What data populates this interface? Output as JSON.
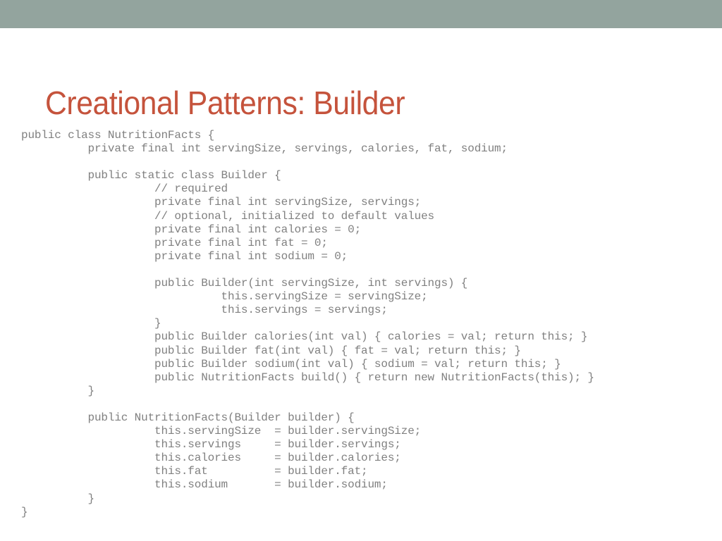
{
  "slide": {
    "title": "Creational Patterns: Builder",
    "accent_color": "#c5533c",
    "header_bar_color": "#93a49e",
    "background_color": "#ffffff",
    "code_color": "#808080"
  },
  "code": {
    "language": "java",
    "lines": [
      "public class NutritionFacts {",
      "          private final int servingSize, servings, calories, fat, sodium;",
      "",
      "          public static class Builder {",
      "                    // required",
      "                    private final int servingSize, servings;",
      "                    // optional, initialized to default values",
      "                    private final int calories = 0;",
      "                    private final int fat = 0;",
      "                    private final int sodium = 0;",
      "",
      "                    public Builder(int servingSize, int servings) {",
      "                              this.servingSize = servingSize;",
      "                              this.servings = servings;",
      "                    }",
      "                    public Builder calories(int val) { calories = val; return this; }",
      "                    public Builder fat(int val) { fat = val; return this; }",
      "                    public Builder sodium(int val) { sodium = val; return this; }",
      "                    public NutritionFacts build() { return new NutritionFacts(this); }",
      "          }",
      "",
      "          public NutritionFacts(Builder builder) {",
      "                    this.servingSize  = builder.servingSize;",
      "                    this.servings     = builder.servings;",
      "                    this.calories     = builder.calories;",
      "                    this.fat          = builder.fat;",
      "                    this.sodium       = builder.sodium;",
      "          }",
      "}"
    ]
  }
}
